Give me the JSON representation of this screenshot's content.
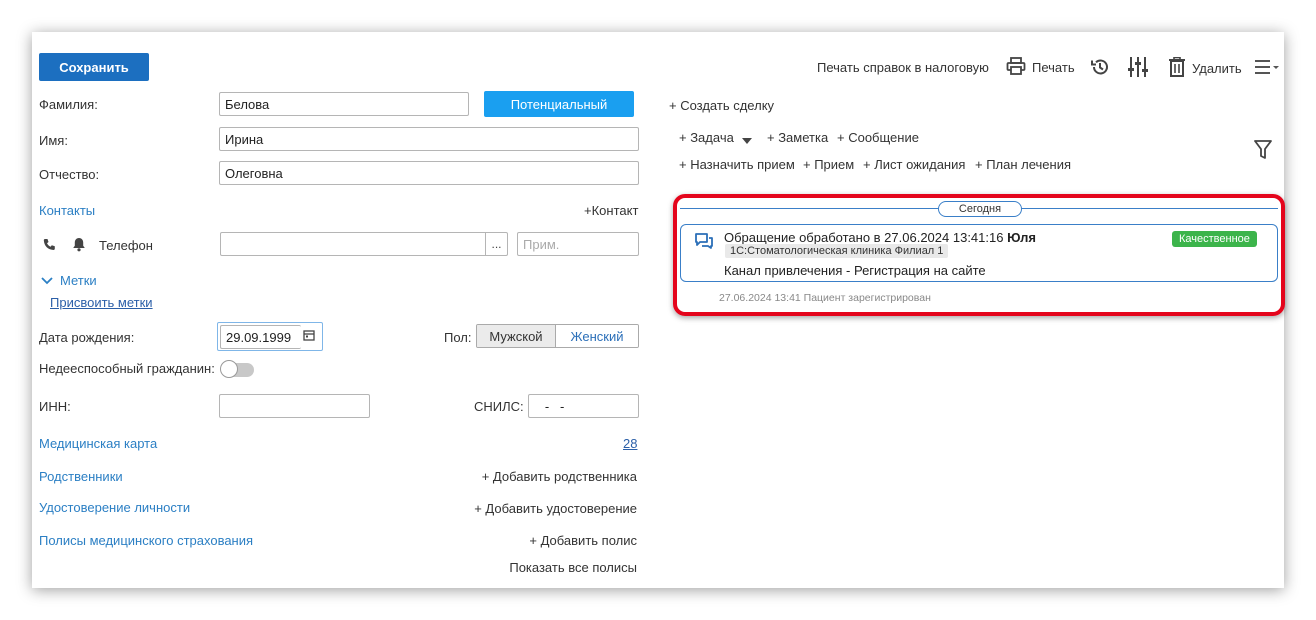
{
  "toolbar": {
    "save_label": "Сохранить",
    "print_tax_label": "Печать справок в налоговую",
    "print_label": "Печать",
    "delete_label": "Удалить"
  },
  "form": {
    "surname_label": "Фамилия:",
    "surname_value": "Белова",
    "status_button": "Потенциальный",
    "name_label": "Имя:",
    "name_value": "Ирина",
    "patronymic_label": "Отчество:",
    "patronymic_value": "Олеговна",
    "contacts_label": "Контакты",
    "add_contact_label": "+Контакт",
    "phone_label": "Телефон",
    "phone_value": "",
    "phone_more": "...",
    "phone_note_placeholder": "Прим.",
    "tags_label": "Метки",
    "assign_tags_label": "Присвоить метки",
    "birth_label": "Дата рождения:",
    "birth_value": "29.09.1999",
    "gender_label": "Пол:",
    "gender_male": "Мужской",
    "gender_female": "Женский",
    "incapable_label": "Недееспособный гражданин:",
    "inn_label": "ИНН:",
    "inn_value": "",
    "snils_label": "СНИЛС:",
    "snils_value": "   -   -",
    "med_card_label": "Медицинская карта",
    "med_card_number": "28",
    "relatives_label": "Родственники",
    "add_relative_label": "+ Добавить родственника",
    "id_doc_label": "Удостоверение личности",
    "add_id_doc_label": "+ Добавить удостоверение",
    "policies_label": "Полисы медицинского страхования",
    "add_policy_label": "+ Добавить полис",
    "show_policies_label": "Показать все полисы"
  },
  "actions": {
    "create_deal": "+ Создать сделку",
    "task": "+ Задача",
    "note": "+ Заметка",
    "message": "+ Сообщение",
    "schedule": "+ Назначить прием",
    "appointment": "+ Прием",
    "waitlist": "+ Лист ожидания",
    "treatment_plan": "+ План лечения"
  },
  "timeline": {
    "today_label": "Сегодня",
    "event_title": "Обращение обработано в 27.06.2024 13:41:16",
    "event_author": "Юля",
    "event_clinic": "1С:Стоматологическая клиника Филиал 1",
    "event_badge": "Качественное",
    "event_text": "Канал привлечения - Регистрация на сайте",
    "footer_text": "27.06.2024 13:41 Пациент зарегистрирован"
  },
  "colors": {
    "primary": "#1c6fc0",
    "status": "#1a9ff0",
    "link": "#2b7fc4",
    "highlight": "#e4051c",
    "badge": "#3cb44b"
  }
}
